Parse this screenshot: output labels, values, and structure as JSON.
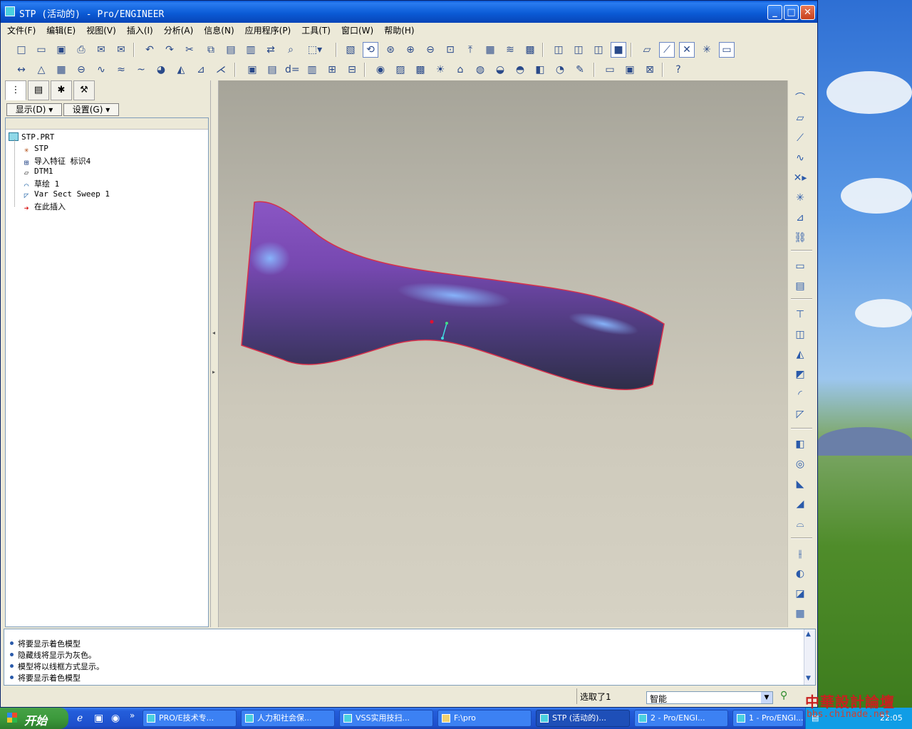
{
  "window": {
    "title": "STP (活动的) - Pro/ENGINEER",
    "buttons": {
      "minimize": "_",
      "maximize": "□",
      "close": "✕"
    }
  },
  "menu": [
    "文件(F)",
    "编辑(E)",
    "视图(V)",
    "插入(I)",
    "分析(A)",
    "信息(N)",
    "应用程序(P)",
    "工具(T)",
    "窗口(W)",
    "帮助(H)"
  ],
  "panel": {
    "show_label": "显示(D)",
    "settings_label": "设置(G)",
    "tree": [
      {
        "label": "STP.PRT",
        "icon": "part-icon"
      },
      {
        "label": "STP",
        "icon": "csys-icon"
      },
      {
        "label": "导入特征 标识4",
        "icon": "import-feature-icon"
      },
      {
        "label": "DTM1",
        "icon": "datum-plane-icon"
      },
      {
        "label": "草绘 1",
        "icon": "sketch-icon"
      },
      {
        "label": "Var Sect Sweep 1",
        "icon": "sweep-icon"
      },
      {
        "label": "在此插入",
        "icon": "insert-here-arrow-icon"
      }
    ]
  },
  "messages": [
    "将要显示着色模型",
    "隐藏线将显示为灰色。",
    "模型将以线框方式显示。",
    "将要显示着色模型"
  ],
  "status": {
    "selected": "选取了1",
    "filter_value": "智能"
  },
  "taskbar": {
    "start": "开始",
    "tasks": [
      {
        "label": "PRO/E技术专...",
        "active": false
      },
      {
        "label": "人力和社会保...",
        "active": false
      },
      {
        "label": "VSS实用技扫...",
        "active": false
      },
      {
        "label": "F:\\pro",
        "active": false
      },
      {
        "label": "STP (活动的)...",
        "active": true
      },
      {
        "label": "2 - Pro/ENGI...",
        "active": false
      },
      {
        "label": "1 - Pro/ENGI...",
        "active": false
      }
    ],
    "clock": "22:05"
  },
  "watermark": {
    "title": "中華設計論壇",
    "url": "bbs.chinade.net"
  },
  "colors": {
    "titlebar": "#0a58d8",
    "model_edge": "#d8304a",
    "model_body": "#7a4aa8",
    "model_highlight": "#6aa8f8"
  }
}
